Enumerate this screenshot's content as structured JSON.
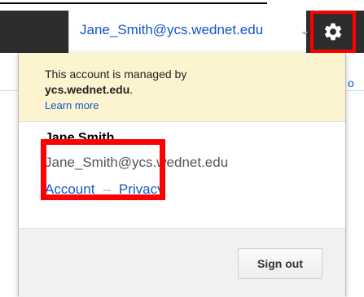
{
  "header": {
    "account_email": "Jane_Smith@ycs.wednet.edu"
  },
  "icons": {
    "settings": "gear-icon",
    "account_menu": "caret-down-icon"
  },
  "notice": {
    "line1": "This account is managed by",
    "domain": "ycs.wednet.edu",
    "domain_suffix": ".",
    "learn_more": "Learn more"
  },
  "user": {
    "name": "Jane Smith",
    "email": "Jane_Smith@ycs.wednet.edu"
  },
  "links": {
    "account": "Account",
    "separator": "–",
    "privacy": "Privacy"
  },
  "footer": {
    "sign_out": "Sign out"
  },
  "page": {
    "fragment": "o"
  },
  "colors": {
    "highlight": "#ff0000",
    "link": "#1155cc",
    "notice_bg": "#fcf4cf",
    "topbar": "#2d2d2d"
  }
}
